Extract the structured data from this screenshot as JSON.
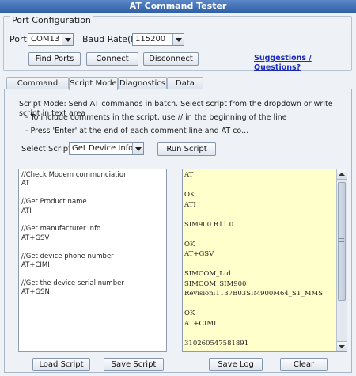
{
  "window": {
    "title": "AT Command Tester"
  },
  "port_config": {
    "group_label": "Port Configuration",
    "port_label": "Port",
    "port_value": "COM13",
    "baud_label": "Baud Rate(bps)",
    "baud_value": "115200",
    "find_ports_label": "Find Ports",
    "connect_label": "Connect",
    "disconnect_label": "Disconnect",
    "suggestions_link": "Suggestions / Questions?"
  },
  "tabs": [
    {
      "label": "Command Mode"
    },
    {
      "label": "Script Mode"
    },
    {
      "label": "Diagnostics"
    },
    {
      "label": "Data Call"
    }
  ],
  "active_tab": "Script Mode",
  "script_mode": {
    "desc_line1": "Script Mode: Send AT commands in batch. Select script from the dropdown or write script in text area",
    "desc_line2": "- To include comments in the script, use // in the beginning of the line",
    "desc_line3": "- Press 'Enter' at the end of each comment line and AT co...",
    "select_label": "Select Script",
    "select_value": "Get Device Info",
    "run_label": "Run Script",
    "script_text": "//Check Modem communciation\nAT\n\n//Get Product name\nATI\n\n//Get manufacturer Info\nAT+GSV\n\n//Get device phone number\nAT+CIMI\n\n//Get the device serial number\nAT+GSN",
    "log_text": "AT\n\nOK\nATI\n\nSIM900 R11.0\n\nOK\nAT+GSV\n\nSIMCOM_Ltd\nSIMCOM_SIM900\nRevision:1137B03SIM900M64_ST_MMS\n\nOK\nAT+CIMI\n\n310260547581891",
    "load_label": "Load Script",
    "save_script_label": "Save Script",
    "save_log_label": "Save Log",
    "clear_label": "Clear"
  },
  "colors": {
    "title_bar": "#2f5fa6",
    "log_background": "#ffffcc",
    "link": "#1b2bb5"
  }
}
